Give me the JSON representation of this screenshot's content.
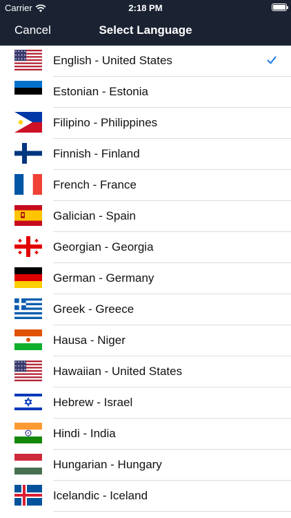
{
  "status": {
    "carrier": "Carrier",
    "time": "2:18 PM"
  },
  "nav": {
    "cancel": "Cancel",
    "title": "Select Language"
  },
  "colors": {
    "header_bg": "#1b2333",
    "check": "#1e7be8"
  },
  "languages": [
    {
      "label": "English - United States",
      "flag": "us-flag-icon",
      "selected": true
    },
    {
      "label": "Estonian - Estonia",
      "flag": "estonia-flag-icon"
    },
    {
      "label": "Filipino - Philippines",
      "flag": "philippines-flag-icon"
    },
    {
      "label": "Finnish - Finland",
      "flag": "finland-flag-icon"
    },
    {
      "label": "French - France",
      "flag": "france-flag-icon"
    },
    {
      "label": "Galician - Spain",
      "flag": "spain-flag-icon"
    },
    {
      "label": "Georgian - Georgia",
      "flag": "georgia-flag-icon"
    },
    {
      "label": "German - Germany",
      "flag": "germany-flag-icon"
    },
    {
      "label": "Greek - Greece",
      "flag": "greece-flag-icon"
    },
    {
      "label": "Hausa - Niger",
      "flag": "niger-flag-icon"
    },
    {
      "label": "Hawaiian - United States",
      "flag": "us-flag-icon"
    },
    {
      "label": "Hebrew - Israel",
      "flag": "israel-flag-icon"
    },
    {
      "label": "Hindi - India",
      "flag": "india-flag-icon"
    },
    {
      "label": "Hungarian - Hungary",
      "flag": "hungary-flag-icon"
    },
    {
      "label": "Icelandic - Iceland",
      "flag": "iceland-flag-icon"
    }
  ]
}
